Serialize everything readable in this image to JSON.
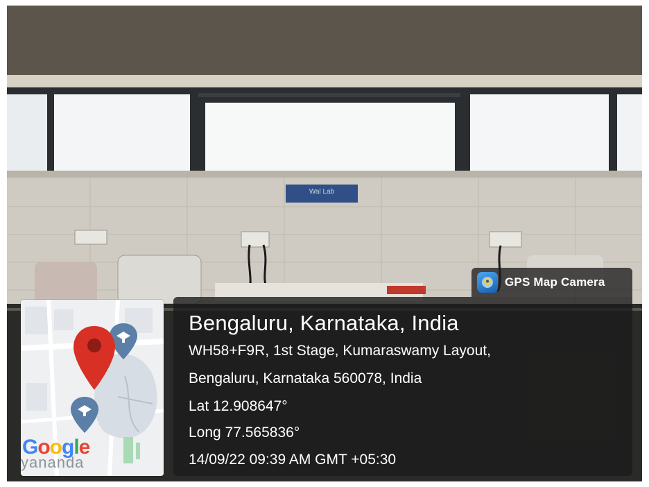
{
  "photo": {
    "description_icons": [
      "window-row",
      "wall-sign",
      "hospital-bed"
    ],
    "sign_text": "Wal Lab"
  },
  "stamp": {
    "app_name": "GPS Map Camera",
    "place": "Bengaluru, Karnataka, India",
    "address_line1": "WH58+F9R, 1st Stage, Kumaraswamy Layout,",
    "address_line2": "Bengaluru, Karnataka 560078, India",
    "latitude": "Lat 12.908647°",
    "longitude": "Long 77.565836°",
    "datetime": "14/09/22 09:39 AM GMT +05:30"
  },
  "map": {
    "logo_text": "Google",
    "map_label": "yananda",
    "pin_color": "#d93025",
    "poi_color": "#5b7fa6"
  },
  "colors": {
    "overlay": "#1c1c1c",
    "text": "#ffffff",
    "google_blue": "#4285f4",
    "google_red": "#ea4335",
    "google_yellow": "#fbbc05",
    "google_green": "#34a853"
  }
}
